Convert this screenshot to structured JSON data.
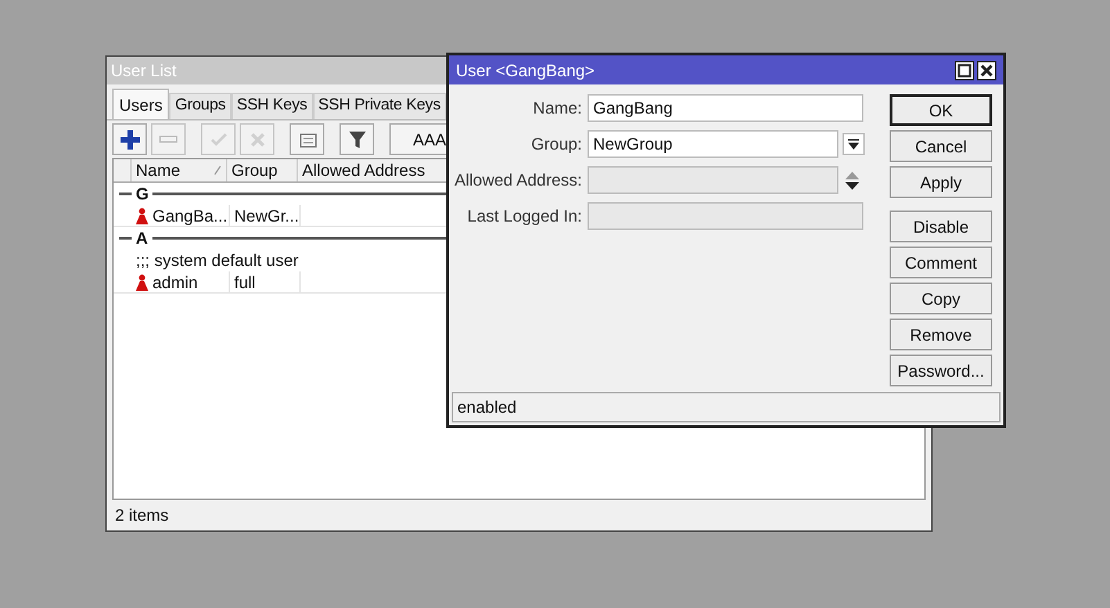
{
  "user_list": {
    "title": "User List",
    "tabs": [
      {
        "label": "Users",
        "selected": true
      },
      {
        "label": "Groups",
        "selected": false
      },
      {
        "label": "SSH Keys",
        "selected": false
      },
      {
        "label": "SSH Private Keys",
        "selected": false
      }
    ],
    "toolbar": [
      {
        "kind": "add",
        "disabled": false
      },
      {
        "kind": "remove",
        "disabled": true
      },
      {
        "kind": "enable",
        "disabled": true
      },
      {
        "kind": "disable",
        "disabled": true
      },
      {
        "kind": "comment",
        "disabled": false
      },
      {
        "kind": "filter",
        "disabled": false
      },
      {
        "kind": "text",
        "label": "AAA",
        "disabled": false
      }
    ],
    "columns": [
      "Name",
      "Group",
      "Allowed Address"
    ],
    "rows": [
      {
        "kind": "group",
        "label": "G"
      },
      {
        "kind": "user",
        "name": "GangBa...",
        "group": "NewGr..."
      },
      {
        "kind": "group",
        "label": "A"
      },
      {
        "kind": "comment",
        "text": ";;; system default user"
      },
      {
        "kind": "user",
        "name": "admin",
        "group": "full"
      }
    ],
    "status": "2 items"
  },
  "dialog": {
    "title": "User <GangBang>",
    "fields": [
      {
        "label": "Name:",
        "kind": "text",
        "value": "GangBang",
        "disabled": false
      },
      {
        "label": "Group:",
        "kind": "dropdown",
        "value": "NewGroup",
        "disabled": false
      },
      {
        "label": "Allowed Address:",
        "kind": "updown",
        "disabled": true
      },
      {
        "label": "Last Logged In:",
        "kind": "text",
        "disabled": true
      }
    ],
    "buttons": [
      {
        "label": "OK",
        "default": true
      },
      {
        "label": "Cancel",
        "default": false
      },
      {
        "label": "Apply",
        "default": false
      },
      {
        "label": "Disable",
        "default": false
      },
      {
        "label": "Comment",
        "default": false
      },
      {
        "label": "Copy",
        "default": false
      },
      {
        "label": "Remove",
        "default": false
      },
      {
        "label": "Password...",
        "default": false
      }
    ],
    "status": "enabled"
  }
}
